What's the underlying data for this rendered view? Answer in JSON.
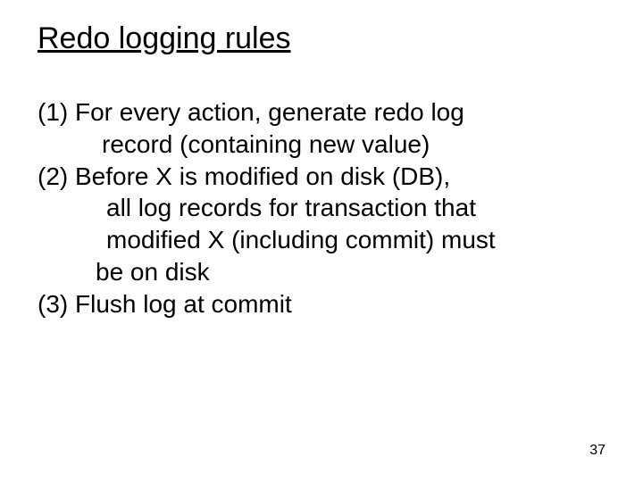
{
  "title": "Redo logging rules",
  "rules": {
    "r1": {
      "marker": "(1) ",
      "line1_rest": "For every action, generate redo log",
      "line2": "record (containing new value)"
    },
    "r2": {
      "marker": "(2) ",
      "line1_rest": "Before X is modified on disk (DB),",
      "line2": "all log records for transaction that",
      "line3": "modified X (including commit) must",
      "line4": "be on disk"
    },
    "r3": {
      "marker": "(3) ",
      "line1_rest": "Flush log at commit"
    }
  },
  "page_number": "37"
}
